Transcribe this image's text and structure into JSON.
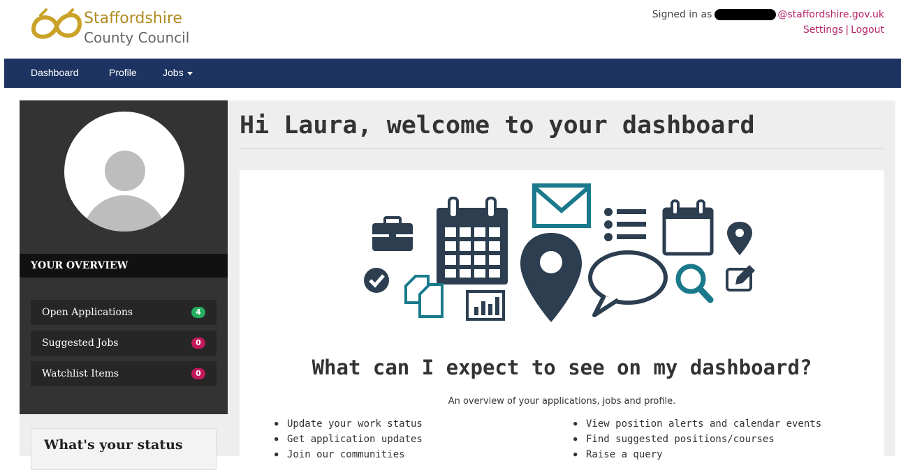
{
  "brand": {
    "line1": "Staffordshire",
    "line2": "County Council"
  },
  "account": {
    "signed_in_prefix": "Signed in as",
    "email_domain": "@staffordshire.gov.uk",
    "settings_label": "Settings",
    "separator": "|",
    "logout_label": "Logout"
  },
  "nav": {
    "items": [
      {
        "label": "Dashboard"
      },
      {
        "label": "Profile"
      },
      {
        "label": "Jobs"
      }
    ]
  },
  "sidebar": {
    "overview_title": "YOUR OVERVIEW",
    "items": [
      {
        "label": "Open Applications",
        "count": "4",
        "badge_color": "#27ae60"
      },
      {
        "label": "Suggested Jobs",
        "count": "0",
        "badge_color": "#c2185b"
      },
      {
        "label": "Watchlist Items",
        "count": "0",
        "badge_color": "#c2185b"
      }
    ],
    "status_title": "What's your status"
  },
  "main": {
    "welcome": "Hi Laura, welcome to your dashboard",
    "question": "What can I expect to see on my dashboard?",
    "intro": "An overview of your applications, jobs and profile.",
    "bullets_left": [
      "Update your work status",
      "Get application updates",
      "Join our communities"
    ],
    "bullets_right": [
      "View position alerts and calendar events",
      "Find suggested positions/courses",
      "Raise a query"
    ]
  },
  "colors": {
    "nav_bg": "#1d3361",
    "sidebar_bg": "#333333",
    "link": "#b5256a",
    "icon_dark": "#2c3e50",
    "icon_teal": "#1a7a8c"
  }
}
